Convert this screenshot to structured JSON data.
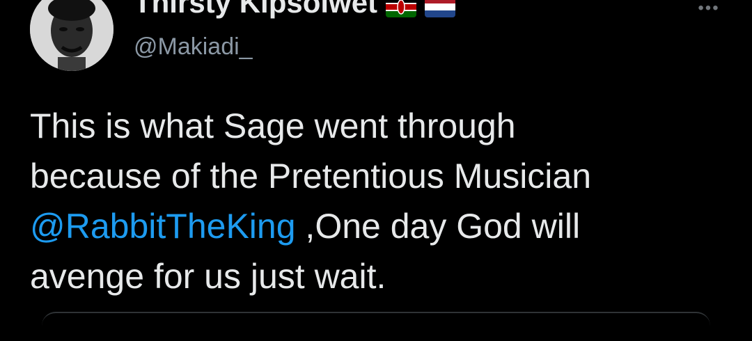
{
  "author": {
    "display_name": "Thirsty Kipsolwet",
    "handle": "@Makiadi_",
    "flags": [
      "kenya-flag-icon",
      "netherlands-flag-icon"
    ]
  },
  "menu": {
    "more_icon": "more-horizontal-icon",
    "more_label": "•••"
  },
  "tweet": {
    "line1": "This is what Sage went through",
    "line2": "because of the Pretentious Musician",
    "mention": "@RabbitTheKing",
    "line3_rest": " ,One day God will",
    "line4": "avenge for us just wait."
  },
  "colors": {
    "background": "#000000",
    "text": "#e7e9ea",
    "secondary_text": "#8b98a5",
    "link": "#1d9bf0"
  }
}
